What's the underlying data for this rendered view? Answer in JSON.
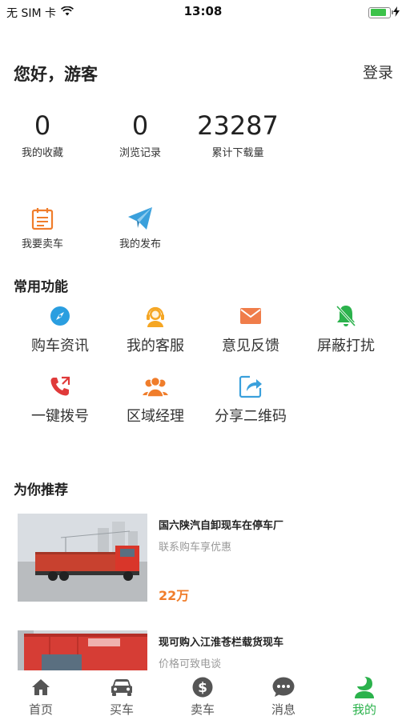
{
  "status_bar": {
    "carrier": "无 SIM 卡",
    "time": "13:08",
    "battery_level": 0.85
  },
  "header": {
    "greeting": "您好，游客",
    "login": "登录"
  },
  "stats": [
    {
      "value": "0",
      "label": "我的收藏"
    },
    {
      "value": "0",
      "label": "浏览记录"
    },
    {
      "value": "23287",
      "label": "累计下载量"
    }
  ],
  "quick_actions": [
    {
      "label": "我要卖车",
      "icon": "calendar-icon",
      "color": "#f07d2b"
    },
    {
      "label": "我的发布",
      "icon": "paper-plane-icon",
      "color": "#3aa0dc"
    }
  ],
  "functions": {
    "title": "常用功能",
    "items": [
      {
        "label": "购车资讯",
        "icon": "compass-icon",
        "color": "#2a9ee0"
      },
      {
        "label": "我的客服",
        "icon": "headset-icon",
        "color": "#f5a623"
      },
      {
        "label": "意见反馈",
        "icon": "mail-icon",
        "color": "#f07d4a"
      },
      {
        "label": "屏蔽打扰",
        "icon": "bell-off-icon",
        "color": "#2bb24c"
      },
      {
        "label": "一键拨号",
        "icon": "phone-icon",
        "color": "#e03a3a"
      },
      {
        "label": "区域经理",
        "icon": "group-icon",
        "color": "#f07d2b"
      },
      {
        "label": "分享二维码",
        "icon": "share-icon",
        "color": "#3aa0dc"
      }
    ]
  },
  "recommend": {
    "title": "为你推荐",
    "items": [
      {
        "title": "国六陕汽自卸现车在停车厂",
        "subtitle": "联系购车享优惠",
        "price": "22万"
      },
      {
        "title": "现可购入江淮苍栏载货现车",
        "subtitle": "价格可致电谈",
        "price": ""
      }
    ]
  },
  "tabbar": {
    "items": [
      {
        "label": "首页",
        "icon": "home-icon"
      },
      {
        "label": "买车",
        "icon": "car-icon"
      },
      {
        "label": "卖车",
        "icon": "dollar-icon"
      },
      {
        "label": "消息",
        "icon": "chat-icon"
      },
      {
        "label": "我的",
        "icon": "user-icon"
      }
    ],
    "active_color": "#2bb24c",
    "inactive_color": "#555555"
  }
}
